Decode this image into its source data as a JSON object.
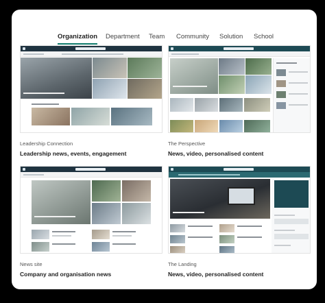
{
  "tabs": [
    {
      "label": "Organization",
      "active": true
    },
    {
      "label": "Department",
      "active": false
    },
    {
      "label": "Team",
      "active": false
    },
    {
      "label": "Community",
      "active": false
    },
    {
      "label": "Solution",
      "active": false
    },
    {
      "label": "School",
      "active": false
    }
  ],
  "accent_color": "#0f7b6c",
  "templates": [
    {
      "subtitle": "Leadership Connection",
      "title": "Leadership news, events, engagement"
    },
    {
      "subtitle": "The Perspective",
      "title": "News, video, personalised content"
    },
    {
      "subtitle": "News site",
      "title": "Company and organisation news"
    },
    {
      "subtitle": "The Landing",
      "title": "News, video, personalised content"
    }
  ]
}
